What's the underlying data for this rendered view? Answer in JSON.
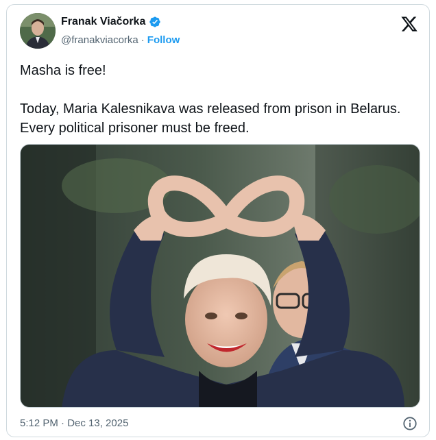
{
  "author": {
    "name": "Franak Viačorka",
    "handle": "@franakviacorka",
    "separator": "·",
    "follow_label": "Follow"
  },
  "tweet": {
    "line1": "Masha is free!",
    "line2": "Today, Maria Kalesnikava was released from prison in Belarus. Every political prisoner must be freed."
  },
  "meta": {
    "timestamp": "5:12 PM · Dec 13, 2025"
  },
  "icons": {
    "verified": "verified-badge-icon",
    "brand": "x-logo-icon",
    "info": "info-icon"
  },
  "colors": {
    "accent": "#1d9bf0",
    "text": "#0f1419",
    "secondary": "#536471",
    "border": "#cfd9de"
  }
}
